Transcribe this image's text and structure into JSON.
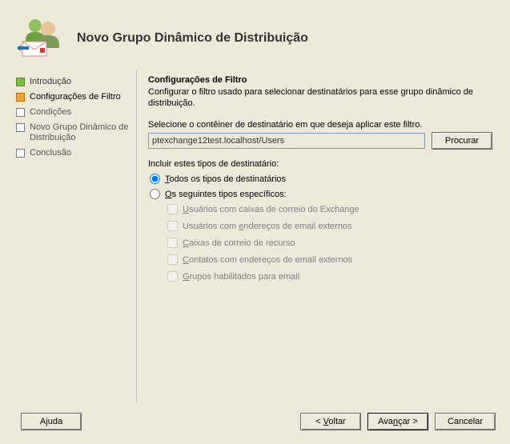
{
  "header": {
    "title": "Novo Grupo Dinâmico de Distribuição"
  },
  "nav": {
    "items": [
      {
        "label": "Introdução",
        "state": "done"
      },
      {
        "label": "Configurações de Filtro",
        "state": "current"
      },
      {
        "label": "Condições",
        "state": "future"
      },
      {
        "label": "Novo Grupo Dinâmico de Distribuição",
        "state": "future"
      },
      {
        "label": "Conclusão",
        "state": "future"
      }
    ]
  },
  "content": {
    "section_title": "Configurações de Filtro",
    "section_desc": "Configurar o filtro usado para selecionar destinatários para esse grupo dinâmico de distribuição.",
    "container_label": "Selecione o contêiner de destinatário em que deseja aplicar este filtro.",
    "container_value": "ptexchange12test.localhost/Users",
    "browse_label": "Procurar",
    "include_label": "Incluir estes tipos de destinatário:",
    "radio_all": {
      "pre": "",
      "accel": "T",
      "post": "odos os tipos de destinatários",
      "checked": true
    },
    "radio_specific": {
      "pre": "",
      "accel": "O",
      "post": "s seguintes tipos específicos:",
      "checked": false
    },
    "checks": [
      {
        "pre": "",
        "accel": "U",
        "post": "suários com caixas de correio do Exchange"
      },
      {
        "pre": "Usuários com ",
        "accel": "e",
        "post": "ndereços de email externos"
      },
      {
        "pre": "",
        "accel": "C",
        "post": "aixas de correio de recurso"
      },
      {
        "pre": "",
        "accel": "C",
        "post": "ontatos com endereços de email externos"
      },
      {
        "pre": "",
        "accel": "G",
        "post": "rupos habilitados para email"
      }
    ]
  },
  "footer": {
    "help": {
      "pre": "A",
      "accel": "j",
      "post": "uda"
    },
    "back": {
      "pre": "< ",
      "accel": "V",
      "post": "oltar"
    },
    "next": {
      "pre": "Ava",
      "accel": "n",
      "post": "çar >"
    },
    "cancel": "Cancelar"
  }
}
